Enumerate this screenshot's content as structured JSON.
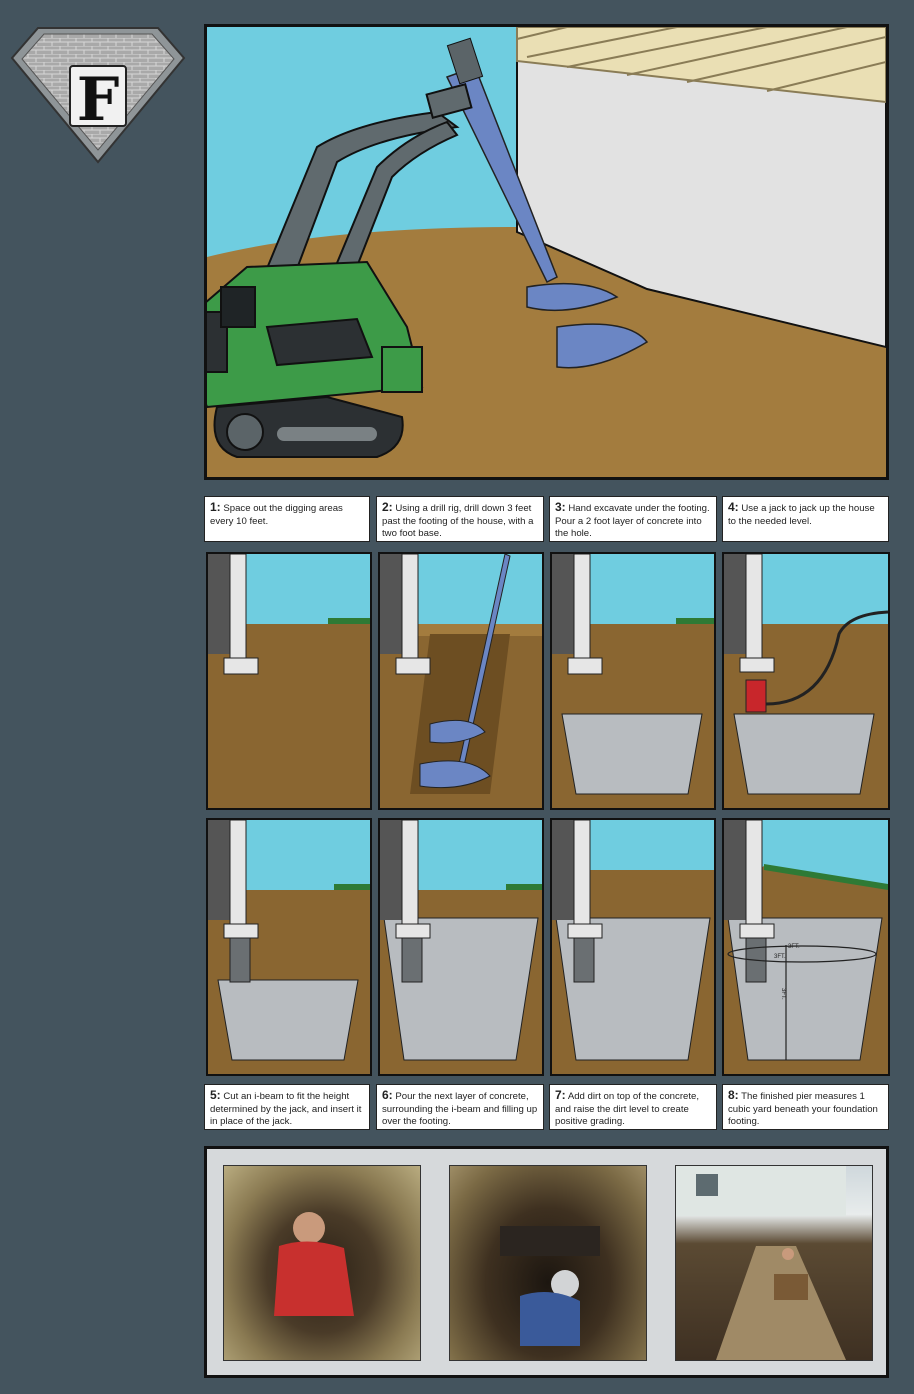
{
  "logo": {
    "letter": "F"
  },
  "captions": [
    {
      "num": "1:",
      "text": "Space out the digging areas every 10 feet."
    },
    {
      "num": "2:",
      "text": "Using a drill rig, drill down 3 feet past the footing of the house, with a two foot base."
    },
    {
      "num": "3:",
      "text": "Hand excavate under the footing. Pour a 2 foot layer of concrete into the hole."
    },
    {
      "num": "4:",
      "text": "Use a jack to jack up the house to the needed level."
    },
    {
      "num": "5:",
      "text": "Cut an i-beam to fit the height determined by the jack, and insert it in place of the jack."
    },
    {
      "num": "6:",
      "text": "Pour the next layer of concrete, surrounding the i-beam and filling up over the footing."
    },
    {
      "num": "7:",
      "text": "Add dirt on top of the concrete, and raise the dirt level to create positive grading."
    },
    {
      "num": "8:",
      "text": "The finished pier measures 1 cubic yard beneath your foundation footing."
    }
  ],
  "dimensions": {
    "width_label": "3FT.",
    "depth_label": "3FT.",
    "height_label": "3FT."
  },
  "colors": {
    "background": "#44545e",
    "sky": "#6fcde0",
    "soil": "#8a6631",
    "ground": "#a37c3e",
    "grass": "#2e7a35",
    "machine": "#3d9b48",
    "auger": "#6b86c4",
    "concrete": "#b8bcc0",
    "wall": "#e2e2e2",
    "jack": "#c8262b"
  }
}
